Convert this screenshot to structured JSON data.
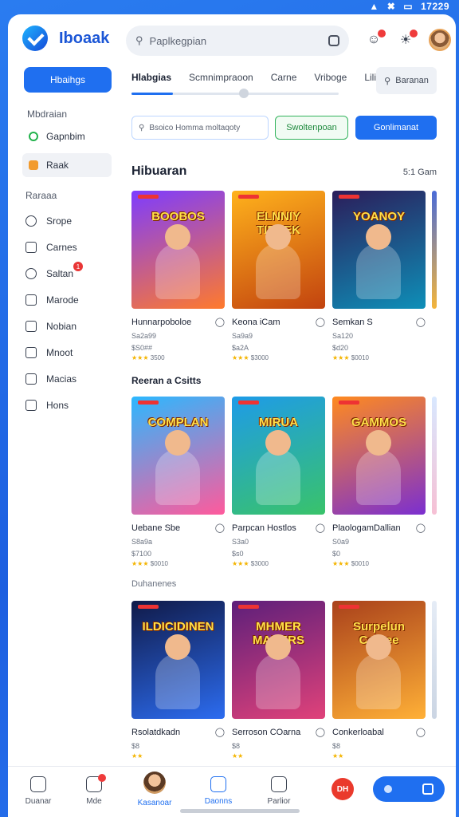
{
  "status": {
    "time": "17229"
  },
  "app": {
    "name": "Iboaak"
  },
  "search": {
    "placeholder": "Paplkegpian"
  },
  "sidebar": {
    "home": "Hbaihgs",
    "section": "Mbdraian",
    "items": [
      {
        "label": "Gapnbim"
      },
      {
        "label": "Raak"
      }
    ],
    "categories_title": "Raraaa",
    "categories": [
      {
        "label": "Srope",
        "icon": "clock-icon"
      },
      {
        "label": "Carnes",
        "icon": "chat-icon"
      },
      {
        "label": "Saltan",
        "icon": "search-icon",
        "badge": "1"
      },
      {
        "label": "Marode",
        "icon": "home-icon"
      },
      {
        "label": "Nobian",
        "icon": "face-icon"
      },
      {
        "label": "Mnoot",
        "icon": "inbox-icon"
      },
      {
        "label": "Macias",
        "icon": "download-icon"
      },
      {
        "label": "Hons",
        "icon": "folder-icon"
      }
    ]
  },
  "tabs": [
    "Hlabgias",
    "Scmnimpraoon",
    "Carne",
    "Vriboge",
    "Lilit"
  ],
  "tab_search": "Baranan",
  "actions": {
    "input": "Bsoico Homma moltaqoty",
    "green": "Swoltenpoan",
    "blue": "Gonlimanat"
  },
  "sections": [
    {
      "title": "Hibuaran",
      "right": "5:1 Gam",
      "games": [
        {
          "name": "Hunnarpoboloe",
          "sub": "Sa2a99",
          "price": "$S0##",
          "rating": "3500",
          "title": "BOOBOS",
          "colors": [
            "#7d3cff",
            "#ff7a2c"
          ]
        },
        {
          "name": "Keona iCam",
          "sub": "Sa9a9",
          "price": "$a2A",
          "rating": "$3000",
          "title": "ELNNIY TIBEEK",
          "colors": [
            "#ffb21c",
            "#c2430f"
          ]
        },
        {
          "name": "Semkan S",
          "sub": "Sa120",
          "price": "$d20",
          "rating": "$0010",
          "title": "YOANOY",
          "colors": [
            "#2b1d5a",
            "#0e8fb8"
          ]
        }
      ]
    },
    {
      "title": "Reeran a Csitts",
      "games": [
        {
          "name": "Uebane Sbe",
          "sub": "S8a9a",
          "price": "$7100",
          "rating": "$0010",
          "title": "COMPLAN",
          "colors": [
            "#2cb8ff",
            "#ff5a9c"
          ]
        },
        {
          "name": "Parpcan Hostlos",
          "sub": "S3a0",
          "price": "$s0",
          "rating": "$3000",
          "title": "MIRUA",
          "colors": [
            "#1e9be8",
            "#39c36a"
          ]
        },
        {
          "name": "PlaologamDallian",
          "sub": "S0a9",
          "price": "$0",
          "rating": "$0010",
          "title": "GAMMOS",
          "colors": [
            "#ff8a1f",
            "#7b2fd0"
          ]
        }
      ]
    },
    {
      "title": "Duhanenes",
      "games": [
        {
          "name": "Rsolatdkadn",
          "sub": "$8",
          "price": "",
          "rating": "",
          "title": "ILDICIDINEN",
          "colors": [
            "#101a48",
            "#2c6cf0"
          ]
        },
        {
          "name": "Serroson COarna",
          "sub": "$8",
          "price": "",
          "rating": "",
          "title": "MHMER MAKERS",
          "colors": [
            "#5d1f7a",
            "#e0427a"
          ]
        },
        {
          "name": "Conkerloabal",
          "sub": "$8",
          "price": "",
          "rating": "",
          "title": "Surpelun Coinee",
          "colors": [
            "#a9411b",
            "#ffb037"
          ]
        }
      ]
    }
  ],
  "bottom_nav": [
    {
      "label": "Duanar",
      "icon": "home-icon"
    },
    {
      "label": "Mde",
      "icon": "chat-icon"
    },
    {
      "label": "Kasanoar",
      "icon": "avatar"
    },
    {
      "label": "Daonns",
      "icon": "search-icon"
    },
    {
      "label": "Parlior",
      "icon": "layers-icon"
    }
  ],
  "bottom_red": "DH"
}
